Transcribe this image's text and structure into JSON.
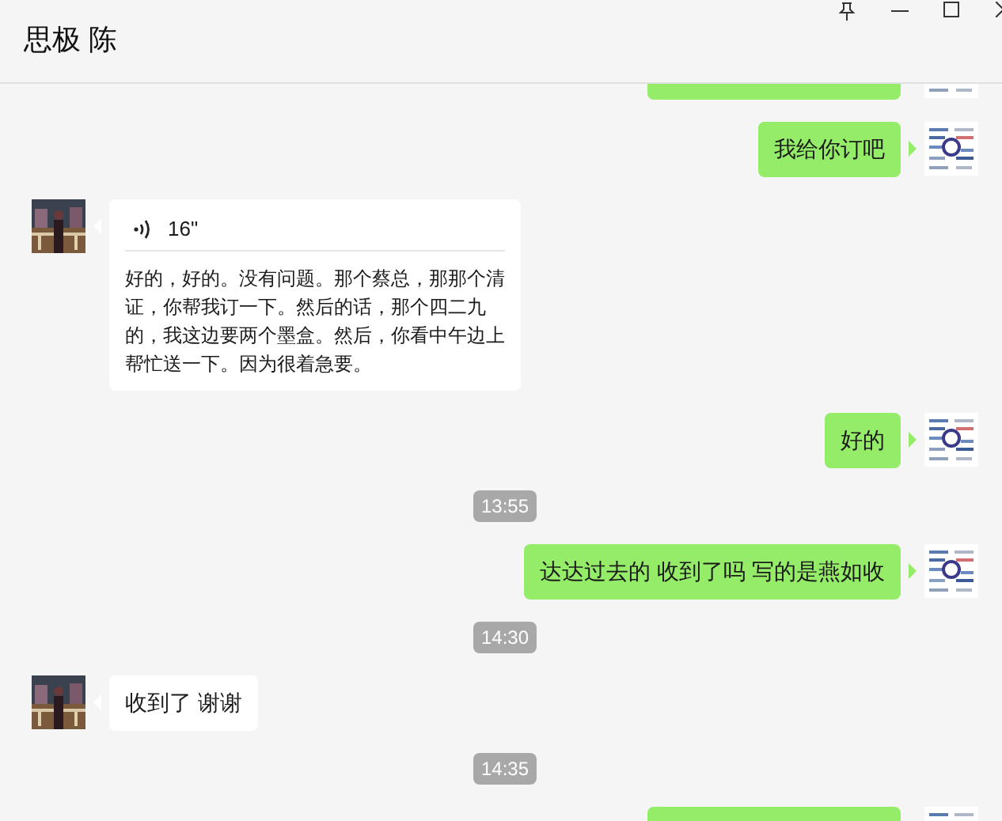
{
  "header": {
    "title": "思极 陈"
  },
  "messages": [
    {
      "kind": "clipped",
      "outgoing": true
    },
    {
      "kind": "text",
      "outgoing": true,
      "text": "我给你订吧"
    },
    {
      "kind": "voice",
      "outgoing": false,
      "duration": "16\"",
      "transcript": "好的，好的。没有问题。那个蔡总，那那个清证，你帮我订一下。然后的话，那个四二九的，我这边要两个墨盒。然后，你看中午边上帮忙送一下。因为很着急要。"
    },
    {
      "kind": "text",
      "outgoing": true,
      "text": "好的"
    },
    {
      "kind": "time",
      "text": "13:55"
    },
    {
      "kind": "text",
      "outgoing": true,
      "text": "达达过去的 收到了吗 写的是燕如收"
    },
    {
      "kind": "time",
      "text": "14:30"
    },
    {
      "kind": "text",
      "outgoing": false,
      "text": "收到了 谢谢"
    },
    {
      "kind": "time",
      "text": "14:35"
    },
    {
      "kind": "clipped",
      "outgoing": true
    }
  ]
}
